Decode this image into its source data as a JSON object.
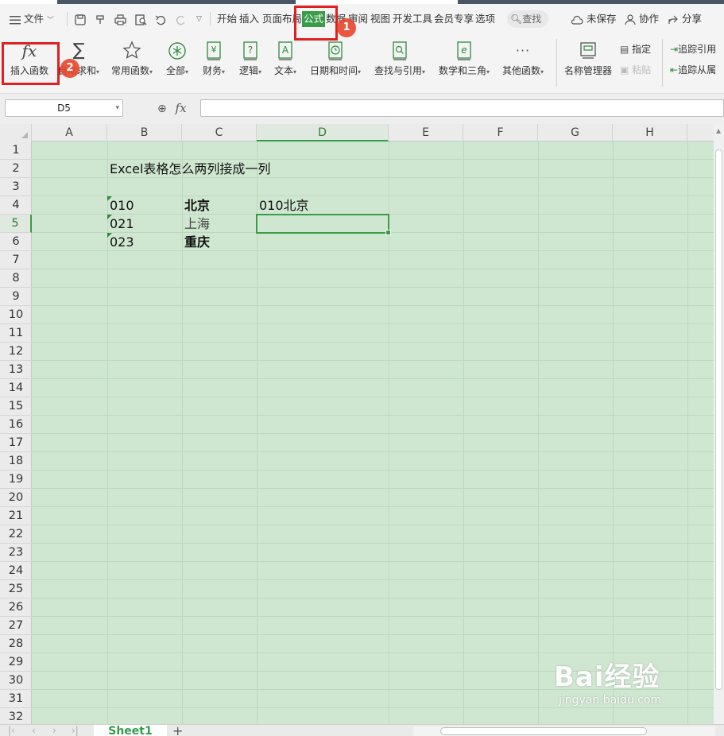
{
  "menubar": {
    "file_label": "文件",
    "tabs": [
      "开始",
      "插入",
      "页面布局",
      "公式",
      "数据",
      "审阅",
      "视图",
      "开发工具",
      "会员专享",
      "选项"
    ],
    "active_tab": "公式",
    "search_label": "查找",
    "unsaved_label": "未保存",
    "collab_label": "协作",
    "share_label": "分享"
  },
  "ribbon": {
    "insert_function": "插入函数",
    "autosum": "自动求和",
    "common_functions": "常用函数",
    "all": "全部",
    "finance": "财务",
    "logic": "逻辑",
    "text": "文本",
    "datetime": "日期和时间",
    "lookup": "查找与引用",
    "math": "数学和三角",
    "other": "其他函数",
    "name_manager": "名称管理器",
    "specify": "指定",
    "paste": "粘贴",
    "trace_precedents": "追踪引用",
    "trace_dependents": "追踪从属"
  },
  "annotations": {
    "badge1": "1",
    "badge2": "2"
  },
  "formula_bar": {
    "name_box": "D5",
    "fx": "fx",
    "formula": ""
  },
  "grid": {
    "columns": [
      "A",
      "B",
      "C",
      "D",
      "E",
      "F",
      "G",
      "H"
    ],
    "selected_column": "D",
    "rows": [
      "1",
      "2",
      "3",
      "4",
      "5",
      "6",
      "7",
      "8",
      "9",
      "10",
      "11",
      "12",
      "13",
      "14",
      "15",
      "16",
      "17",
      "18",
      "19",
      "20",
      "21",
      "22",
      "23",
      "24",
      "25",
      "26",
      "27",
      "28",
      "29",
      "30",
      "31",
      "32"
    ],
    "selected_row": "5",
    "cells": {
      "B2": "Excel表格怎么两列接成一列",
      "B4": "010",
      "C4": "北京",
      "D4": "010北京",
      "B5": "021",
      "C5": "上海",
      "B6": "023",
      "C6": "重庆"
    }
  },
  "sheets": {
    "tabs": [
      "Sheet1"
    ],
    "add": "+"
  },
  "watermark": {
    "logo": "Bai经验",
    "url": "jingyan.baidu.com"
  },
  "colors": {
    "accent": "#3a9c48",
    "grid_bg": "#cfe7d1",
    "annotation": "#e02020"
  }
}
